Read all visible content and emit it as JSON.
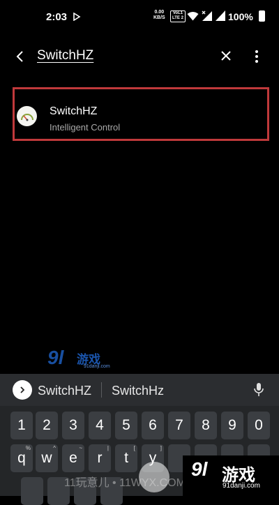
{
  "status_bar": {
    "time": "2:03",
    "speed_value": "0.00",
    "speed_unit": "KB/S",
    "volte_top": "VoL1",
    "volte_bottom": "LTE 2",
    "battery": "100%"
  },
  "search": {
    "query": "SwitchHZ"
  },
  "results": [
    {
      "name": "SwitchHZ",
      "subtitle": "Intelligent Control",
      "icon": "speedometer-app-icon"
    }
  ],
  "keyboard": {
    "suggestions": [
      "SwitchHZ",
      "SwitchHz"
    ],
    "number_row": [
      "1",
      "2",
      "3",
      "4",
      "5",
      "6",
      "7",
      "8",
      "9",
      "0"
    ],
    "letter_row": [
      {
        "key": "q",
        "hint": "%"
      },
      {
        "key": "w",
        "hint": "^"
      },
      {
        "key": "e",
        "hint": "~"
      },
      {
        "key": "r",
        "hint": "|"
      },
      {
        "key": "t",
        "hint": "["
      },
      {
        "key": "y",
        "hint": "]"
      }
    ]
  },
  "watermarks": {
    "center_logo": "9l",
    "center_text": "游戏",
    "center_domain": "91danji.com",
    "bottom_text": "11玩意儿 • 11WYX.COM",
    "right_logo": "9l",
    "right_text": "游戏",
    "right_domain": "91danji.com"
  }
}
